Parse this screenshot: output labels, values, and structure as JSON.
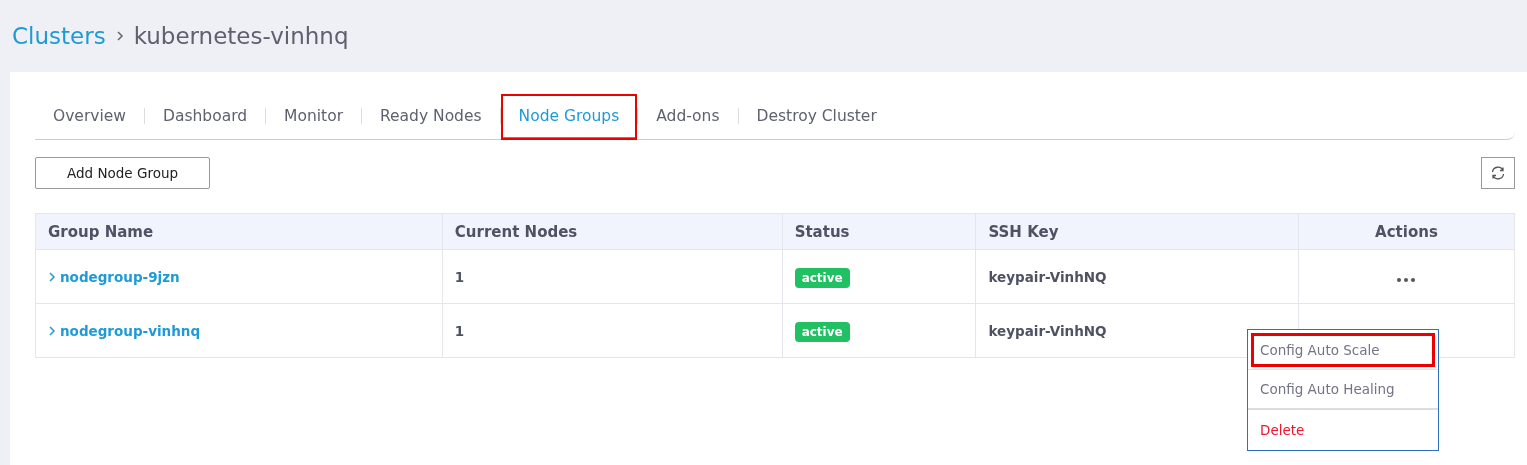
{
  "breadcrumb": [
    {
      "label": "Clusters",
      "kind": "link"
    },
    {
      "label": "kubernetes-vinhnq",
      "kind": "current"
    }
  ],
  "tabs": [
    {
      "label": "Overview",
      "selected": false,
      "highlighted": false
    },
    {
      "label": "Dashboard",
      "selected": false,
      "highlighted": false
    },
    {
      "label": "Monitor",
      "selected": false,
      "highlighted": false
    },
    {
      "label": "Ready Nodes",
      "selected": false,
      "highlighted": false
    },
    {
      "label": "Node Groups",
      "selected": true,
      "highlighted": true
    },
    {
      "label": "Add-ons",
      "selected": false,
      "highlighted": false
    },
    {
      "label": "Destroy Cluster",
      "selected": false,
      "highlighted": false
    }
  ],
  "add_button": "Add Node Group",
  "table": {
    "columns": [
      "Group Name",
      "Current Nodes",
      "Status",
      "SSH Key",
      "Actions"
    ],
    "rows": [
      {
        "group_name": "nodegroup-9jzn",
        "current_nodes": "1",
        "status": "active",
        "ssh_key": "keypair-VinhNQ"
      },
      {
        "group_name": "nodegroup-vinhnq",
        "current_nodes": "1",
        "status": "active",
        "ssh_key": "keypair-VinhNQ"
      }
    ]
  },
  "action_menu": {
    "items": [
      {
        "label": "Config Auto Scale",
        "kind": "normal",
        "highlighted": true
      },
      {
        "label": "Config Auto Healing",
        "kind": "normal",
        "highlighted": false
      },
      {
        "label": "Delete",
        "kind": "danger",
        "highlighted": false
      }
    ]
  }
}
